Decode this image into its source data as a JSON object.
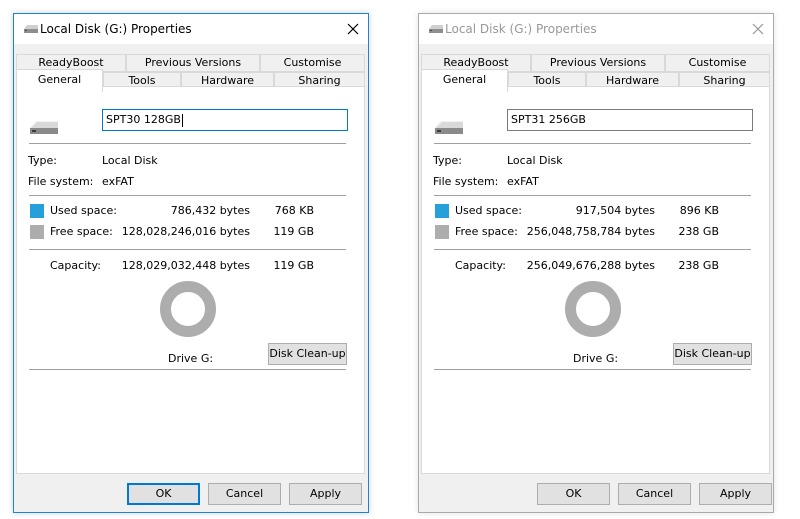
{
  "colors": {
    "used": "#26a0da",
    "free": "#adadad"
  },
  "windows": [
    {
      "title": "Local Disk (G:) Properties",
      "tabs_back": [
        "ReadyBoost",
        "Previous Versions",
        "Customise"
      ],
      "tabs_front": [
        "General",
        "Tools",
        "Hardware",
        "Sharing"
      ],
      "selected_tab": "General",
      "volume_label": "SPT30 128GB",
      "type_label": "Type:",
      "type_value": "Local Disk",
      "fs_label": "File system:",
      "fs_value": "exFAT",
      "used_label": "Used space:",
      "used_bytes": "786,432 bytes",
      "used_size": "768 KB",
      "free_label": "Free space:",
      "free_bytes": "128,028,246,016 bytes",
      "free_size": "119 GB",
      "capacity_label": "Capacity:",
      "capacity_bytes": "128,029,032,448 bytes",
      "capacity_size": "119 GB",
      "drive_label": "Drive G:",
      "cleanup_button": "Disk Clean-up",
      "ok_button": "OK",
      "cancel_button": "Cancel",
      "apply_button": "Apply"
    },
    {
      "title": "Local Disk (G:) Properties",
      "tabs_back": [
        "ReadyBoost",
        "Previous Versions",
        "Customise"
      ],
      "tabs_front": [
        "General",
        "Tools",
        "Hardware",
        "Sharing"
      ],
      "selected_tab": "General",
      "volume_label": "SPT31 256GB",
      "type_label": "Type:",
      "type_value": "Local Disk",
      "fs_label": "File system:",
      "fs_value": "exFAT",
      "used_label": "Used space:",
      "used_bytes": "917,504 bytes",
      "used_size": "896 KB",
      "free_label": "Free space:",
      "free_bytes": "256,048,758,784 bytes",
      "free_size": "238 GB",
      "capacity_label": "Capacity:",
      "capacity_bytes": "256,049,676,288 bytes",
      "capacity_size": "238 GB",
      "drive_label": "Drive G:",
      "cleanup_button": "Disk Clean-up",
      "ok_button": "OK",
      "cancel_button": "Cancel",
      "apply_button": "Apply"
    }
  ]
}
